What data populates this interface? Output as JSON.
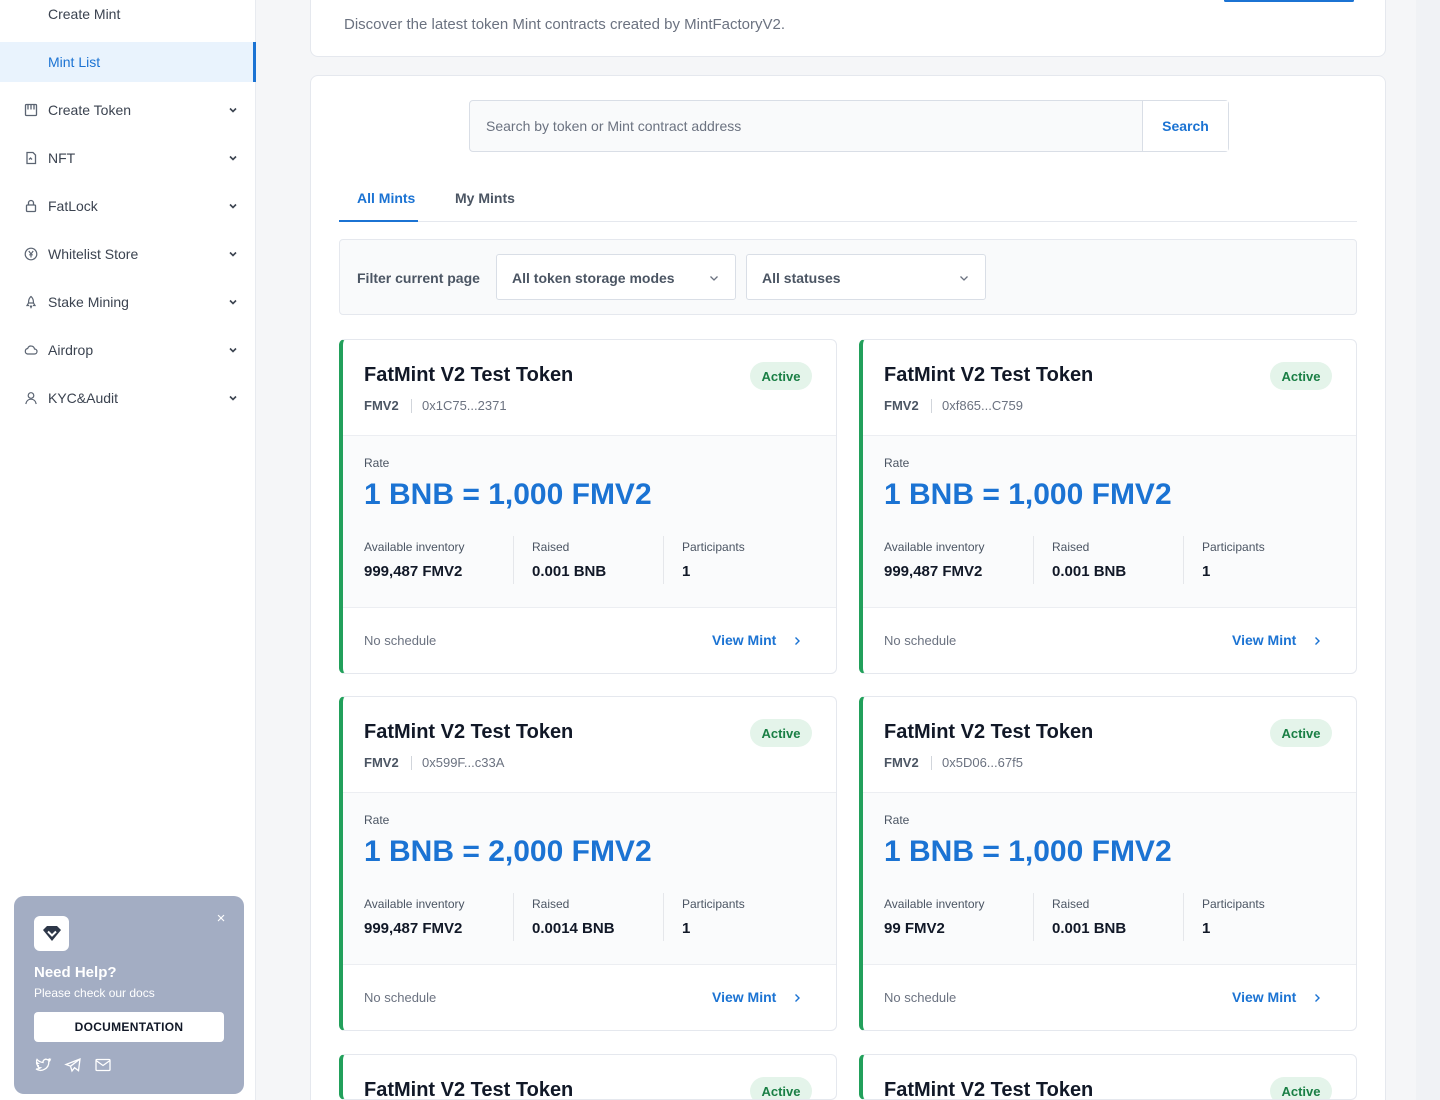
{
  "sidebar": {
    "items": [
      {
        "label": "Create Mint",
        "icon": "none",
        "expandable": false,
        "active": false
      },
      {
        "label": "Mint List",
        "icon": "none",
        "expandable": false,
        "active": true
      },
      {
        "label": "Create Token",
        "icon": "token-icon",
        "expandable": true,
        "active": false
      },
      {
        "label": "NFT",
        "icon": "nft-icon",
        "expandable": true,
        "active": false
      },
      {
        "label": "FatLock",
        "icon": "lock-icon",
        "expandable": true,
        "active": false
      },
      {
        "label": "Whitelist Store",
        "icon": "yen-coin-icon",
        "expandable": true,
        "active": false
      },
      {
        "label": "Stake Mining",
        "icon": "rocket-icon",
        "expandable": true,
        "active": false
      },
      {
        "label": "Airdrop",
        "icon": "cloud-icon",
        "expandable": true,
        "active": false
      },
      {
        "label": "KYC&Audit",
        "icon": "user-icon",
        "expandable": true,
        "active": false
      }
    ]
  },
  "help": {
    "title": "Need Help?",
    "subtitle": "Please check our docs",
    "button": "DOCUMENTATION",
    "close": "×"
  },
  "header": {
    "description": "Discover the latest token Mint contracts created by MintFactoryV2."
  },
  "search": {
    "placeholder": "Search by token or Mint contract address",
    "value": "",
    "button": "Search"
  },
  "tabs": [
    {
      "label": "All Mints",
      "active": true
    },
    {
      "label": "My Mints",
      "active": false
    }
  ],
  "filters": {
    "label": "Filter current page",
    "storage_mode": "All token storage modes",
    "status": "All statuses"
  },
  "labels": {
    "rate": "Rate",
    "inventory": "Available inventory",
    "raised": "Raised",
    "participants": "Participants",
    "view": "View Mint"
  },
  "mints": [
    {
      "name": "FatMint V2 Test Token",
      "status": "Active",
      "symbol": "FMV2",
      "address": "0x1C75...2371",
      "rate": "1 BNB = 1,000 FMV2",
      "inventory": "999,487 FMV2",
      "raised": "0.001 BNB",
      "participants": "1",
      "schedule": "No schedule"
    },
    {
      "name": "FatMint V2 Test Token",
      "status": "Active",
      "symbol": "FMV2",
      "address": "0xf865...C759",
      "rate": "1 BNB = 1,000 FMV2",
      "inventory": "999,487 FMV2",
      "raised": "0.001 BNB",
      "participants": "1",
      "schedule": "No schedule"
    },
    {
      "name": "FatMint V2 Test Token",
      "status": "Active",
      "symbol": "FMV2",
      "address": "0x599F...c33A",
      "rate": "1 BNB = 2,000 FMV2",
      "inventory": "999,487 FMV2",
      "raised": "0.0014 BNB",
      "participants": "1",
      "schedule": "No schedule"
    },
    {
      "name": "FatMint V2 Test Token",
      "status": "Active",
      "symbol": "FMV2",
      "address": "0x5D06...67f5",
      "rate": "1 BNB = 1,000 FMV2",
      "inventory": "99 FMV2",
      "raised": "0.001 BNB",
      "participants": "1",
      "schedule": "No schedule"
    },
    {
      "name": "FatMint V2 Test Token",
      "status": "Active"
    },
    {
      "name": "FatMint V2 Test Token",
      "status": "Active"
    }
  ],
  "colors": {
    "accent": "#1b73d3",
    "active_badge_bg": "#e4f4ea",
    "active_badge_text": "#1a7f45",
    "card_border_active": "#22a05b",
    "help_bg": "#a3adc3"
  }
}
